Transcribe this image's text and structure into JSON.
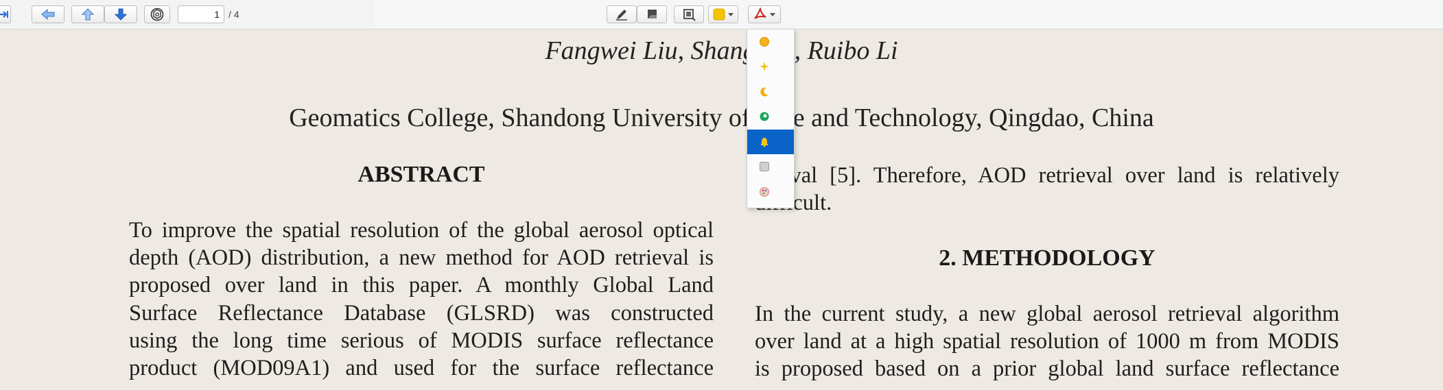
{
  "toolbar": {
    "page_current": "1",
    "page_total": "/ 4",
    "highlight_color": "#f5c400",
    "pdf_color": "#d21f1f",
    "buttons": [
      {
        "name": "go-to-page-icon"
      },
      {
        "name": "back-arrow-icon"
      },
      {
        "name": "previous-page-icon"
      },
      {
        "name": "next-page-icon"
      },
      {
        "name": "chatgpt-icon"
      },
      {
        "name": "pen-icon"
      },
      {
        "name": "stamp-icon"
      },
      {
        "name": "snapshot-icon"
      },
      {
        "name": "color-square-icon"
      },
      {
        "name": "acrobat-icon"
      }
    ]
  },
  "dropdown": {
    "items": [
      {
        "name": "sun-icon",
        "selected": false
      },
      {
        "name": "sparkle-icon",
        "selected": false
      },
      {
        "name": "moon-icon",
        "selected": false
      },
      {
        "name": "green-sphere-icon",
        "selected": false
      },
      {
        "name": "bell-icon",
        "selected": true
      },
      {
        "name": "gray-square-icon",
        "selected": false
      },
      {
        "name": "palette-icon",
        "selected": false
      }
    ]
  },
  "document": {
    "authors_line": "Fangwei Liu, Shang        Jia, Ruibo Li",
    "affiliation": "Geomatics College, Shandong University of        ence and Technology, Qingdao, China",
    "abstract_title": "ABSTRACT",
    "abstract_lines": [
      "To improve the spatial resolution of the global aerosol optical",
      "depth (AOD) distribution, a new method for AOD retrieval is",
      "proposed over land in this paper. A monthly Global Land",
      "Surface Reflectance Database (GLSRD) was constructed",
      "using the long time serious of MODIS surface reflectance",
      "product (MOD09A1) and used for the surface reflectance"
    ],
    "right_intro_lines": [
      "ieval [5]. Therefore, AOD retrieval over land is relatively",
      "difficult."
    ],
    "methodology_title": "2. METHODOLOGY",
    "methodology_lines": [
      "In the current study, a new global aerosol retrieval algorithm",
      "over land at a high spatial resolution of 1000 m from MODIS",
      "is proposed based on a prior global land surface reflectance"
    ]
  }
}
